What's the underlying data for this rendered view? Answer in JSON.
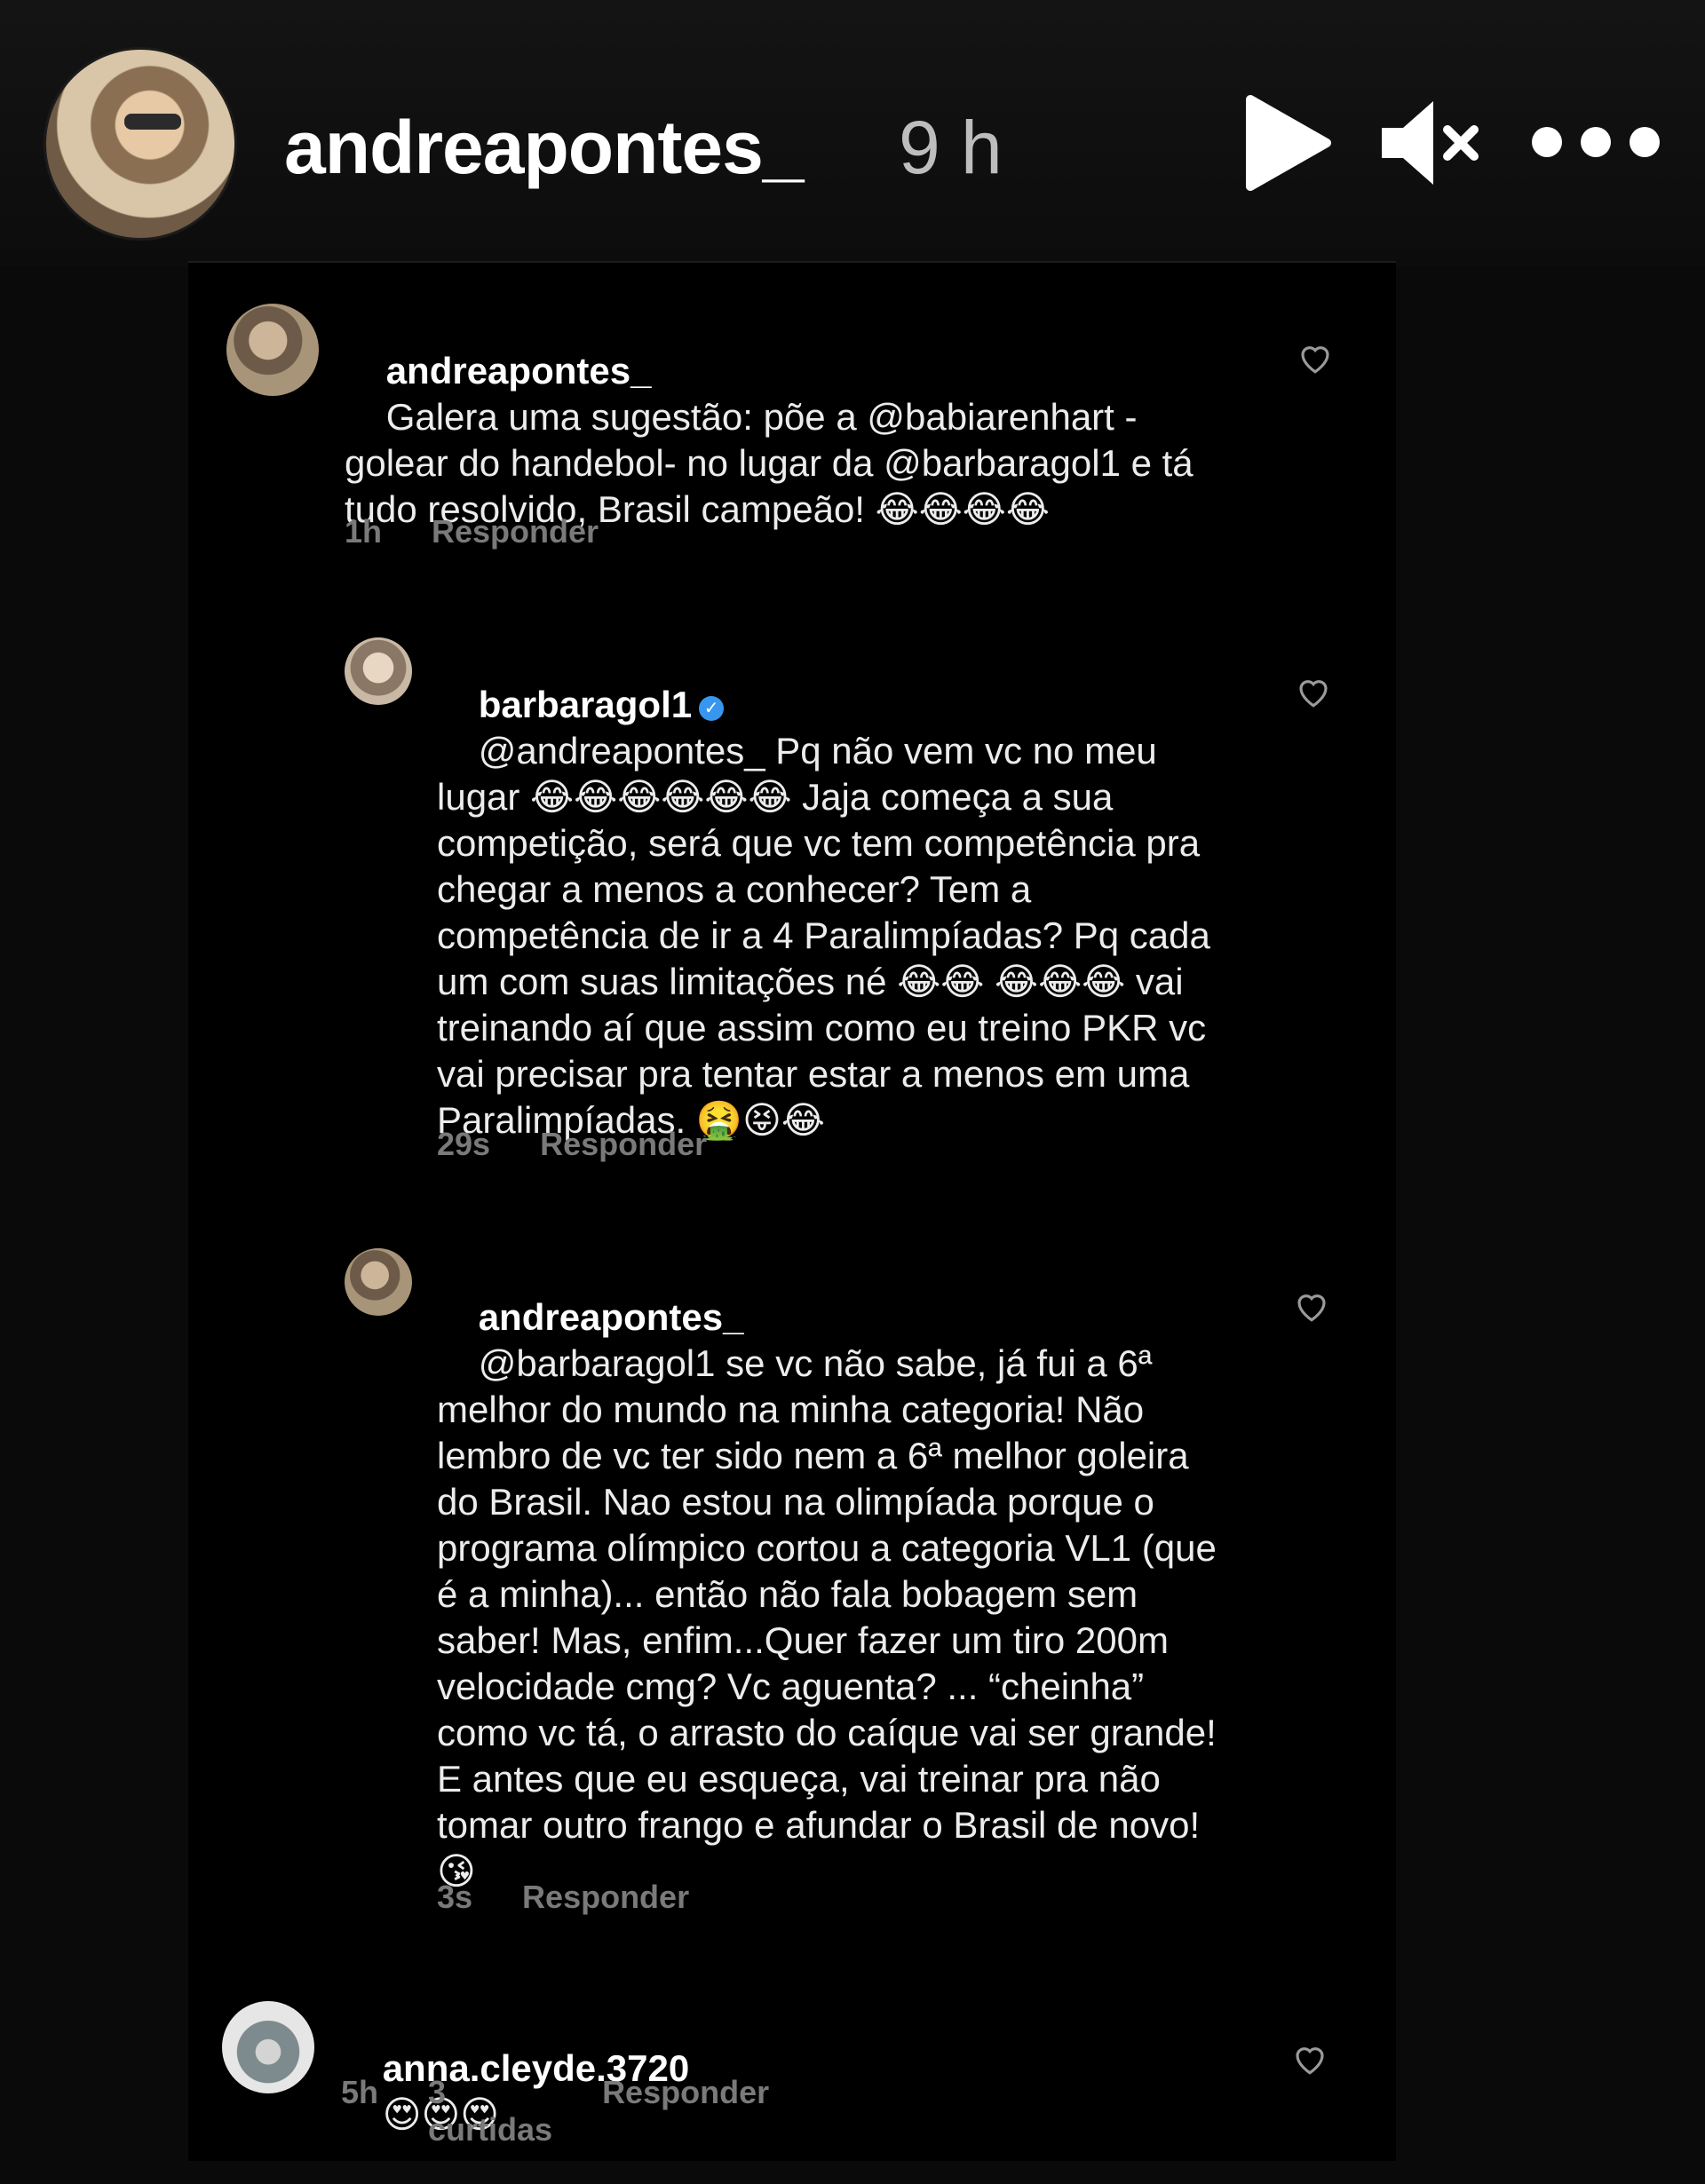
{
  "header": {
    "username": "andreapontes_",
    "time": "9 h",
    "icons": [
      "play-icon",
      "mute-icon",
      "more-icon"
    ]
  },
  "comments": [
    {
      "username": "andreapontes_",
      "verified": false,
      "text": "Galera uma sugestão: põe a @babiarenhart - golear do handebol- no lugar da @barbaragol1 e tá tudo resolvido, Brasil campeão! 😂😂😂😂",
      "time": "1h",
      "likes": "",
      "reply_label": "Responder"
    },
    {
      "username": "barbaragol1",
      "verified": true,
      "text": "@andreapontes_ Pq não vem vc no meu lugar 😂😂😂😂😂😂 Jaja começa a sua competição, será que vc tem competência pra chegar a menos a conhecer? Tem a competência de ir a 4 Paralimpíadas? Pq cada um com suas limitações né 😂😂 😂😂😂 vai treinando aí que assim como eu treino PKR vc vai precisar pra tentar estar a menos em uma Paralimpíadas. 🤮😝😂",
      "time": "29s",
      "likes": "",
      "reply_label": "Responder"
    },
    {
      "username": "andreapontes_",
      "verified": false,
      "text": "@barbaragol1 se vc não sabe, já fui a 6ª melhor do mundo na minha categoria! Não lembro de vc ter sido nem a 6ª melhor goleira do Brasil. Nao estou na olimpíada porque o programa olímpico cortou a categoria VL1 (que é a minha)... então não fala bobagem sem saber! Mas, enfim...Quer fazer um tiro 200m velocidade cmg? Vc aguenta? ... “cheinha” como vc tá, o arrasto do caíque vai ser grande! E antes que eu esqueça, vai treinar pra não tomar outro frango e afundar o Brasil de novo! 😘",
      "time": "3s",
      "likes": "",
      "reply_label": "Responder"
    },
    {
      "username": "anna.cleyde.3720",
      "verified": false,
      "text": "😍😍😍",
      "time": "5h",
      "likes": "3 curtidas",
      "reply_label": "Responder"
    }
  ]
}
